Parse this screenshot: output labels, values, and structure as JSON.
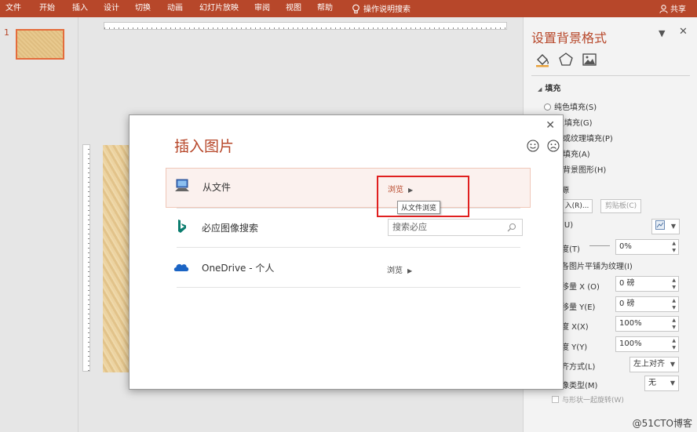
{
  "ribbon": {
    "tabs": [
      "文件",
      "开始",
      "插入",
      "设计",
      "切换",
      "动画",
      "幻灯片放映",
      "审阅",
      "视图",
      "帮助"
    ],
    "tell_me": "操作说明搜索",
    "share": "共享"
  },
  "thumbnails": {
    "slide_number": "1"
  },
  "dialog": {
    "title": "插入图片",
    "close_glyph": "✕",
    "rows": [
      {
        "label": "从文件",
        "action": "浏览"
      },
      {
        "label": "必应图像搜索",
        "search_placeholder": "搜索必应"
      },
      {
        "label": "OneDrive - 个人",
        "action": "浏览"
      }
    ],
    "tooltip": "从文件浏览"
  },
  "pane": {
    "title": "设置背景格式",
    "section_fill": "填充",
    "fill_options": [
      "纯色填充(S)",
      "变填充(G)",
      "片或纹理填充(P)",
      "案填充(A)",
      "藏背景图形(H)"
    ],
    "source_label": "源",
    "insert_button": "入(R)...",
    "clipboard_button": "剪贴板(C)",
    "texture_label": "(U)",
    "transparency_label": "度(T)",
    "transparency_value": "0%",
    "tile_label": "各图片平铺为纹理(I)",
    "offset_x_label": "移量 X (O)",
    "offset_x_value": "0 磅",
    "offset_y_label": "移量 Y(E)",
    "offset_y_value": "0 磅",
    "scale_x_label": "度 X(X)",
    "scale_x_value": "100%",
    "scale_y_label": "度 Y(Y)",
    "scale_y_value": "100%",
    "align_label": "齐方式(L)",
    "align_value": "左上对齐",
    "mirror_label": "像类型(M)",
    "mirror_value": "无",
    "rotate_checkbox": "与形状一起旋转(W)"
  },
  "watermark": "@51CTO博客",
  "colors": {
    "accent": "#b7472a",
    "highlight": "#e02020"
  }
}
